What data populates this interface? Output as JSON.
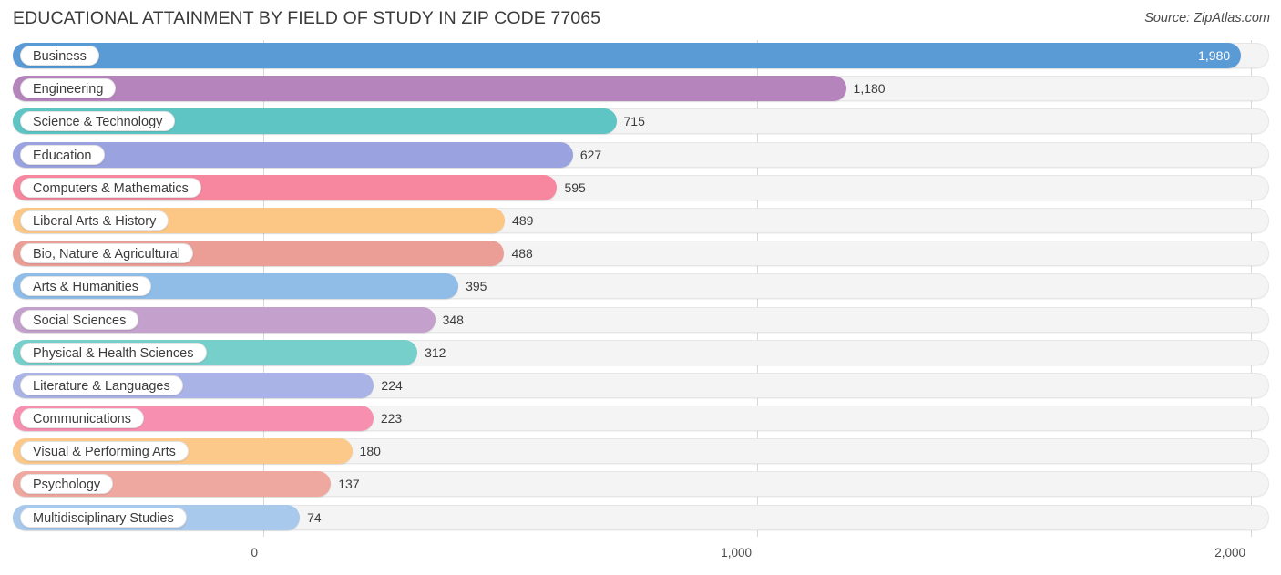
{
  "header": {
    "title": "EDUCATIONAL ATTAINMENT BY FIELD OF STUDY IN ZIP CODE 77065",
    "source": "Source: ZipAtlas.com"
  },
  "chart_data": {
    "type": "bar",
    "orientation": "horizontal",
    "title": "EDUCATIONAL ATTAINMENT BY FIELD OF STUDY IN ZIP CODE 77065",
    "xlabel": "",
    "ylabel": "",
    "xlim": [
      0,
      2000
    ],
    "grid": true,
    "legend": false,
    "xticks": [
      0,
      1000,
      2000
    ],
    "xtick_labels": [
      "0",
      "1,000",
      "2,000"
    ],
    "categories": [
      "Business",
      "Engineering",
      "Science & Technology",
      "Education",
      "Computers & Mathematics",
      "Liberal Arts & History",
      "Bio, Nature & Agricultural",
      "Arts & Humanities",
      "Social Sciences",
      "Physical & Health Sciences",
      "Literature & Languages",
      "Communications",
      "Visual & Performing Arts",
      "Psychology",
      "Multidisciplinary Studies"
    ],
    "values": [
      1980,
      1180,
      715,
      627,
      595,
      489,
      488,
      395,
      348,
      312,
      224,
      223,
      180,
      137,
      74
    ],
    "value_labels": [
      "1,980",
      "1,180",
      "715",
      "627",
      "595",
      "489",
      "488",
      "395",
      "348",
      "312",
      "224",
      "223",
      "180",
      "137",
      "74"
    ],
    "colors": [
      "#5b9bd5",
      "#b584bd",
      "#5ec4c4",
      "#9aa3e0",
      "#f7869f",
      "#fcc685",
      "#eb9e96",
      "#8fbde8",
      "#c4a1cc",
      "#76cfcb",
      "#aab3e6",
      "#f78fb0",
      "#fcc98a",
      "#efa8a0",
      "#a8c9ec"
    ]
  }
}
